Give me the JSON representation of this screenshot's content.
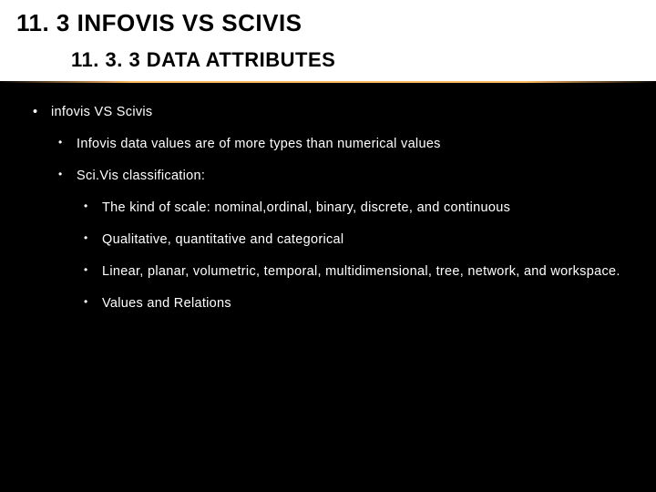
{
  "title": "11. 3 INFOVIS VS SCIVIS",
  "subtitle": "11. 3. 3 DATA ATTRIBUTES",
  "bullets": {
    "l0": "infovis VS Scivis",
    "l1a": "Infovis data values are of more types than numerical values",
    "l1b": "Sci.Vis classification:",
    "l2a": "The kind of scale: nominal,ordinal, binary, discrete, and continuous",
    "l2b": "Qualitative, quantitative and categorical",
    "l2c": "Linear, planar, volumetric, temporal, multidimensional, tree, network, and workspace.",
    "l2d": "Values and Relations"
  }
}
